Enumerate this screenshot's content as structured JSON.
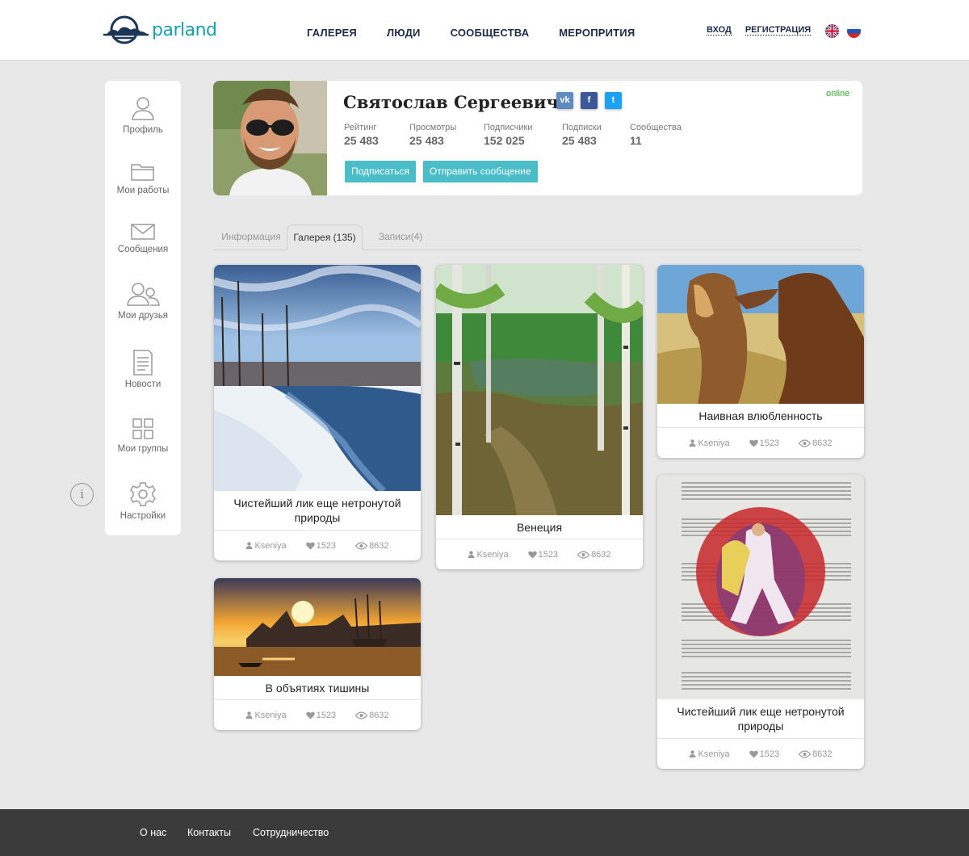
{
  "header": {
    "logo_text": "parland",
    "nav": [
      "ГАЛЕРЕЯ",
      "ЛЮДИ",
      "СООБЩЕСТВА",
      "МЕРОПРИТИЯ"
    ],
    "login": "ВХОД",
    "register": "РЕГИСТРАЦИЯ",
    "languages": [
      "en-flag-icon",
      "ru-flag-icon"
    ]
  },
  "sidebar": {
    "items": [
      {
        "label": "Профиль",
        "icon": "user-icon"
      },
      {
        "label": "Мои работы",
        "icon": "folder-icon"
      },
      {
        "label": "Сообщения",
        "icon": "envelope-icon"
      },
      {
        "label": "Мои друзья",
        "icon": "friends-icon"
      },
      {
        "label": "Новости",
        "icon": "news-icon"
      },
      {
        "label": "Мои группы",
        "icon": "groups-icon"
      },
      {
        "label": "Настройки",
        "icon": "gear-icon"
      }
    ],
    "info": "i"
  },
  "profile": {
    "name": "Святослав Сергеевич",
    "status": "online",
    "socials": [
      {
        "name": "vk-icon",
        "text": "vk",
        "color": "#5f8bc3"
      },
      {
        "name": "facebook-icon",
        "text": "f",
        "color": "#3b5998"
      },
      {
        "name": "twitter-icon",
        "text": "t",
        "color": "#1da1f2"
      }
    ],
    "stats": [
      {
        "label": "Рейтинг",
        "value": "25 483"
      },
      {
        "label": "Просмотры",
        "value": "25 483"
      },
      {
        "label": "Подписчики",
        "value": "152 025"
      },
      {
        "label": "Подписки",
        "value": "25 483"
      },
      {
        "label": "Сообщества",
        "value": "11"
      }
    ],
    "subscribe": "Подписаться",
    "message": "Отправить сообщение"
  },
  "tabs": [
    "Информация",
    "Галерея (135)",
    "Записи(4)"
  ],
  "cards": [
    {
      "title": "Чистейший лик еще нетронутой природы",
      "author": "Kseniya",
      "likes": "1523",
      "views": "8632"
    },
    {
      "title": "Венеция",
      "author": "Kseniya",
      "likes": "1523",
      "views": "8632"
    },
    {
      "title": "Наивная влюбленность",
      "author": "Kseniya",
      "likes": "1523",
      "views": "8632"
    },
    {
      "title": "В объятиях тишины",
      "author": "Kseniya",
      "likes": "1523",
      "views": "8632"
    },
    {
      "title": "Чистейший лик еще нетронутой природы",
      "author": "Kseniya",
      "likes": "1523",
      "views": "8632"
    }
  ],
  "footer": [
    "О нас",
    "Контакты",
    "Сотрудничество"
  ],
  "colors": {
    "accent": "#4bbdc8",
    "brand": "#17a0b5",
    "nav": "#1d2b46",
    "footer": "#3b3b3b",
    "online": "#2fa531"
  }
}
